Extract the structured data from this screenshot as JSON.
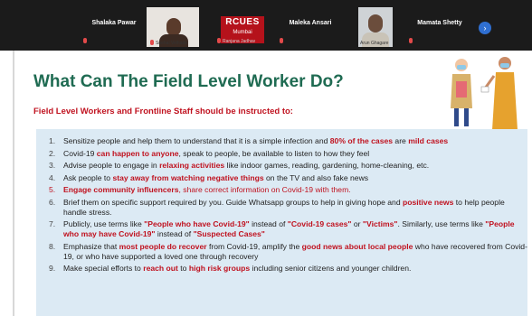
{
  "meeting": {
    "participants": [
      {
        "name": "Shalaka Pawar",
        "sub": ""
      },
      {
        "name": "",
        "sub": "Snehal Velhade"
      },
      {
        "name": "",
        "sub": "Ranjana Jadhav"
      },
      {
        "name": "Maleka Ansari",
        "sub": ""
      },
      {
        "name": "",
        "sub": "Arun Ghagare"
      },
      {
        "name": "Mamata Shetty",
        "sub": ""
      }
    ],
    "logo_line1": "RCUES",
    "logo_line2": "Mumbai",
    "next_icon": "chevron-right-icon"
  },
  "slide": {
    "title": "What Can The Field Level Worker Do?",
    "subtitle": "Field Level Workers and Frontline Staff should be instructed to:",
    "items": [
      {
        "num": "1.",
        "parts": [
          {
            "t": "Sensitize people and help them to understand that it is a simple infection and "
          },
          {
            "t": "80% of the cases",
            "r": true
          },
          {
            "t": " are "
          },
          {
            "t": "mild cases",
            "r": true
          }
        ]
      },
      {
        "num": "2.",
        "parts": [
          {
            "t": "Covid-19 "
          },
          {
            "t": "can happen to anyone",
            "r": true
          },
          {
            "t": ", speak to people, be available to listen to how they feel"
          }
        ]
      },
      {
        "num": "3.",
        "parts": [
          {
            "t": "Advise people to engage in "
          },
          {
            "t": "relaxing activities",
            "r": true
          },
          {
            "t": " like indoor games, reading, gardening, home-cleaning, etc."
          }
        ]
      },
      {
        "num": "4.",
        "parts": [
          {
            "t": "Ask people to "
          },
          {
            "t": "stay away from watching negative things",
            "r": true
          },
          {
            "t": " on the TV and also fake news"
          }
        ]
      },
      {
        "num": "5.",
        "hot": true,
        "parts": [
          {
            "t": "Engage community influencers",
            "r": true
          },
          {
            "t": ", share correct information on Covid-19 with them."
          }
        ]
      },
      {
        "num": "6.",
        "parts": [
          {
            "t": "Brief them on specific support required by you. Guide Whatsapp groups to help in giving hope and "
          },
          {
            "t": "positive news",
            "r": true
          },
          {
            "t": " to help people handle stress."
          }
        ]
      },
      {
        "num": "7.",
        "parts": [
          {
            "t": "Publicly, use terms like "
          },
          {
            "t": "\"People who have Covid-19\"",
            "r": true
          },
          {
            "t": " instead of "
          },
          {
            "t": "\"Covid-19 cases\"",
            "r": true
          },
          {
            "t": " or "
          },
          {
            "t": "\"Victims\"",
            "r": true
          },
          {
            "t": ". Similarly, use terms like "
          },
          {
            "t": "\"People who may have Covid-19\"",
            "r": true
          },
          {
            "t": " instead of "
          },
          {
            "t": "\"Suspected Cases\"",
            "r": true
          }
        ]
      },
      {
        "num": "8.",
        "parts": [
          {
            "t": "Emphasize that "
          },
          {
            "t": "most people do recover",
            "r": true
          },
          {
            "t": " from Covid-19, amplify the "
          },
          {
            "t": "good news about local people",
            "r": true
          },
          {
            "t": " who have recovered from Covid-19, or who have supported a loved one through recovery"
          }
        ]
      },
      {
        "num": "9.",
        "parts": [
          {
            "t": "Make special efforts to "
          },
          {
            "t": "reach out",
            "r": true
          },
          {
            "t": " to "
          },
          {
            "t": "high risk groups",
            "r": true
          },
          {
            "t": " including senior citizens and younger children."
          }
        ]
      }
    ]
  },
  "colors": {
    "title": "#1f6b52",
    "accent": "#c0121f",
    "panel": "#dceaf4",
    "topbar": "#1b1b1b"
  }
}
